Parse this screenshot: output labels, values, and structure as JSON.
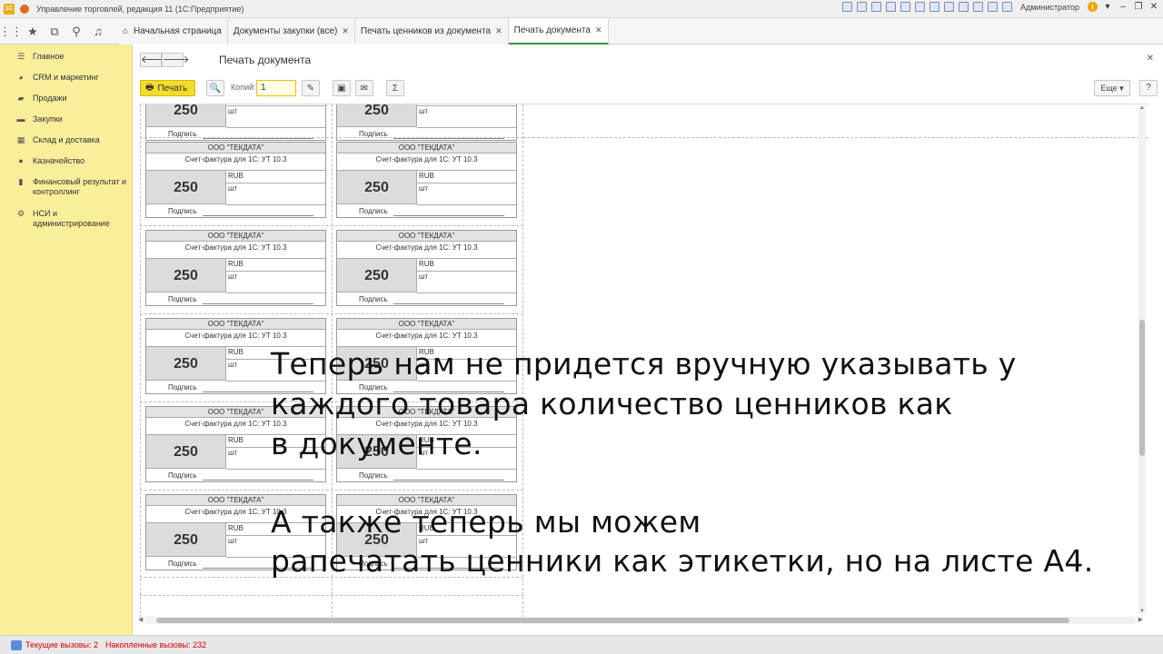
{
  "window": {
    "title": "Управление торговлей, редакция 11  (1С:Предприятие)",
    "user": "Администратор"
  },
  "tabs": [
    {
      "label": "Начальная страница",
      "closable": false
    },
    {
      "label": "Документы закупки (все)",
      "closable": true
    },
    {
      "label": "Печать ценников из документа",
      "closable": true
    },
    {
      "label": "Печать документа",
      "closable": true,
      "active": true
    }
  ],
  "sidebar": {
    "items": [
      {
        "label": "Главное",
        "icon": "menu-lines-icon"
      },
      {
        "label": "CRM и маркетинг",
        "icon": "crm-icon"
      },
      {
        "label": "Продажи",
        "icon": "sales-icon"
      },
      {
        "label": "Закупки",
        "icon": "cart-icon"
      },
      {
        "label": "Склад и доставка",
        "icon": "warehouse-icon"
      },
      {
        "label": "Казначейство",
        "icon": "treasury-icon"
      },
      {
        "label": "Финансовый результат и контроллинг",
        "icon": "chart-icon"
      },
      {
        "label": "НСИ и администрирование",
        "icon": "gear-icon"
      }
    ]
  },
  "document": {
    "title": "Печать документа",
    "toolbar": {
      "print_label": "Печать",
      "copies_label": "Копий:",
      "copies_value": "1",
      "more_label": "Еще",
      "help_label": "?"
    }
  },
  "price_tag": {
    "org": "ООО \"ТЕКДАТА\"",
    "description": "Счет-фактура для 1С: УТ 10.3",
    "price": "250",
    "currency": "RUB",
    "unit": "шт",
    "signature_label": "Подпись"
  },
  "overlay": {
    "lines": [
      "Теперь нам не придется вручную указывать у",
      "каждого товара количество ценников как",
      "в документе.",
      "А также теперь мы можем",
      "рапечатать ценники как этикетки, но на листе А4."
    ]
  },
  "status": {
    "current_calls": "Текущие вызовы: 2",
    "accumulated_calls": "Накопленные вызовы: 232"
  }
}
